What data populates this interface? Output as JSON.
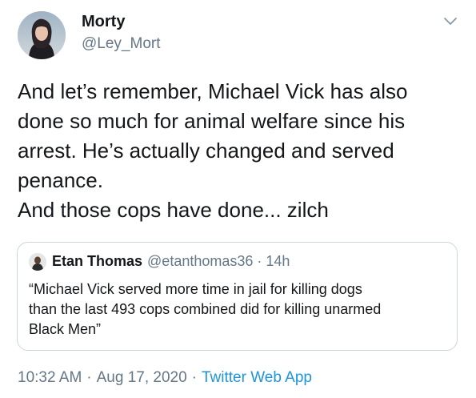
{
  "author": {
    "display_name": "Morty",
    "handle": "@Ley_Mort"
  },
  "tweet": {
    "lines": [
      "And let’s remember, Michael Vick has also",
      "done so much for animal welfare since his",
      "arrest. He’s actually changed and served",
      "penance.",
      "And those cops have done... zilch"
    ]
  },
  "quoted_tweet": {
    "display_name": "Etan Thomas",
    "handle": "@etanthomas36",
    "separator": "·",
    "time": "14h",
    "lines": [
      "“Michael Vick served more time in jail for killing dogs",
      "than the last 493 cops combined did for killing unarmed",
      "Black Men”"
    ]
  },
  "footer": {
    "time": "10:32 AM",
    "separator1": "·",
    "date": "Aug 17, 2020",
    "separator2": "·",
    "source": "Twitter Web App"
  },
  "icons": {
    "menu": "chevron-down-icon"
  },
  "colors": {
    "text": "#14171a",
    "secondary": "#657786",
    "link": "#1b95e0",
    "border": "#ccd6dd"
  }
}
